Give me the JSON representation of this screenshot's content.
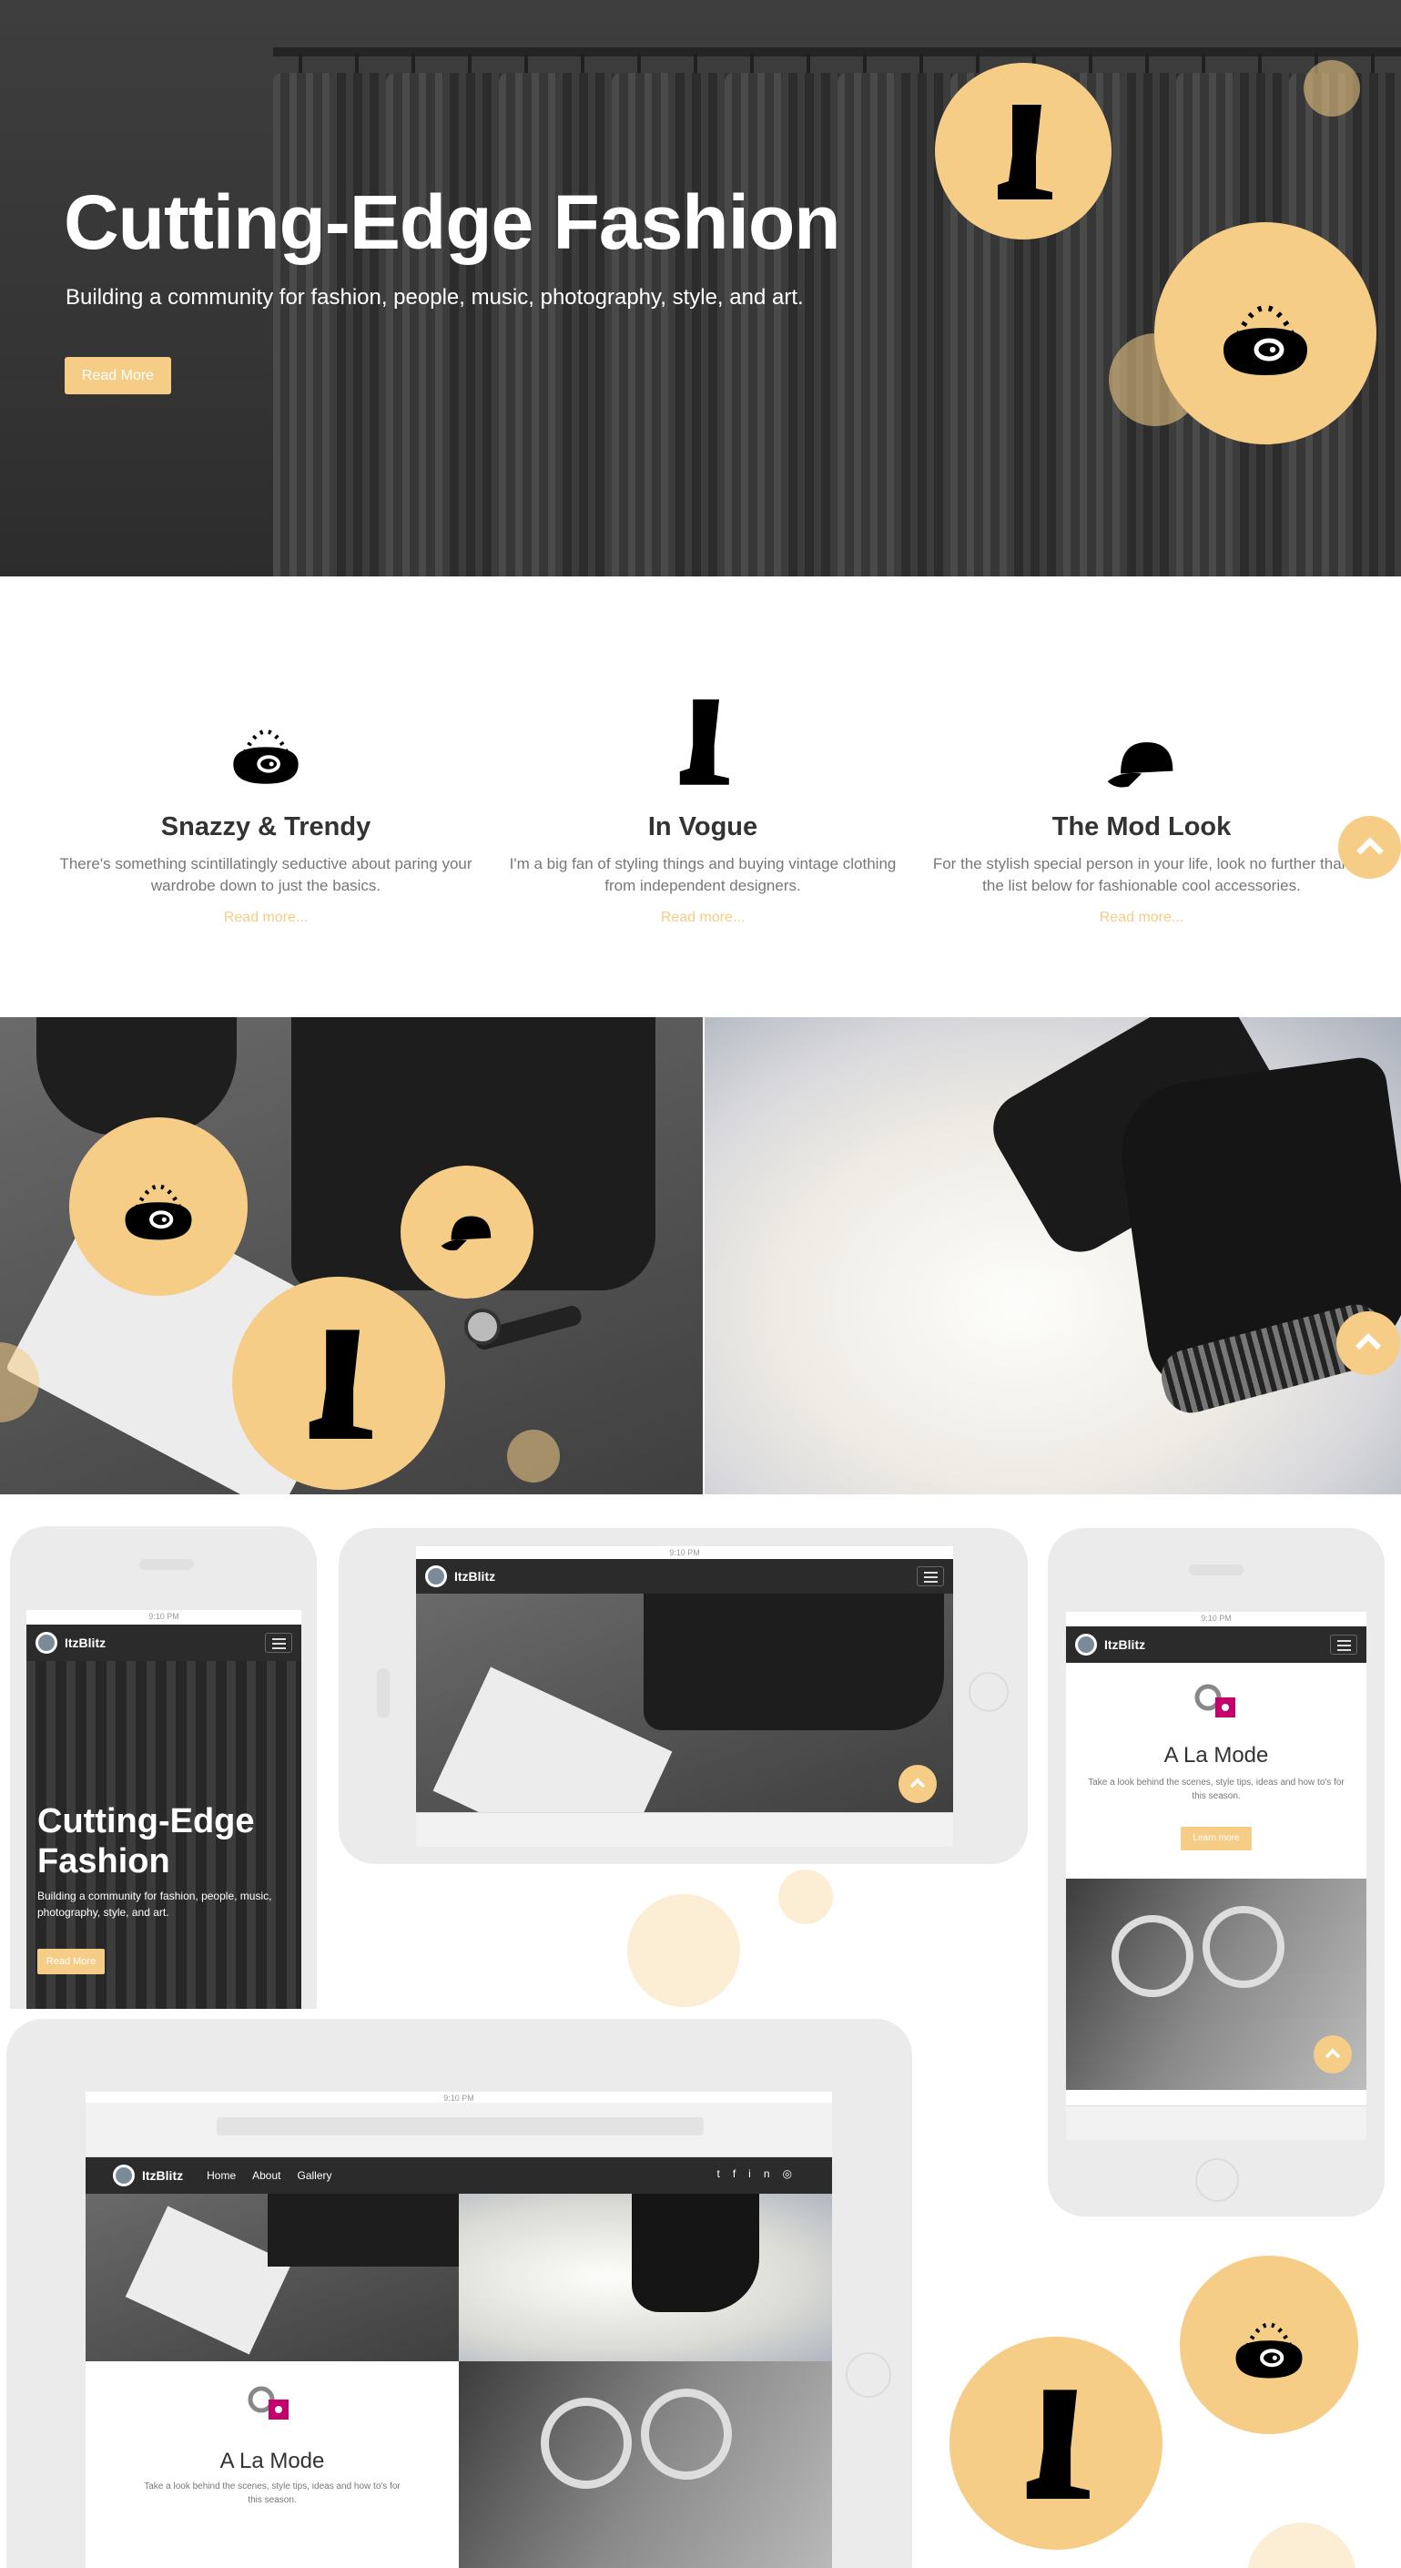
{
  "hero": {
    "title": "Cutting-Edge Fashion",
    "subtitle": "Building a community for fashion, people, music, photography, style, and art.",
    "button": "Read More"
  },
  "features": [
    {
      "icon": "handbag-icon",
      "title": "Snazzy & Trendy",
      "text": "There's something scintillatingly seductive about paring your wardrobe down to just the basics.",
      "link": "Read more..."
    },
    {
      "icon": "boot-icon",
      "title": "In Vogue",
      "text": "I'm a big fan of styling things and buying vintage clothing from independent designers.",
      "link": "Read more..."
    },
    {
      "icon": "cap-icon",
      "title": "The Mod Look",
      "text": "For the stylish special person in your life, look no further than the list below for fashionable cool accessories.",
      "link": "Read more..."
    }
  ],
  "devices": {
    "brand": "ItzBlitz",
    "time": "9:10 PM",
    "phone_hero_title": "Cutting-Edge Fashion",
    "phone_hero_subtitle": "Building a community for fashion, people, music, photography, style, and art.",
    "phone_hero_button": "Read More",
    "alamode_title": "A La Mode",
    "alamode_text": "Take a look behind the scenes, style tips, ideas and how to's for this season.",
    "alamode_button": "Learn more",
    "tablet_nav": [
      "Home",
      "About",
      "Gallery"
    ],
    "social_icons": [
      "twitter-icon",
      "facebook-icon",
      "linkedin-icon",
      "instagram-icon"
    ]
  },
  "colors": {
    "accent": "#f6cd86",
    "dark": "#2b2b2b",
    "magenta": "#c4006d",
    "device": "#ebebeb"
  }
}
